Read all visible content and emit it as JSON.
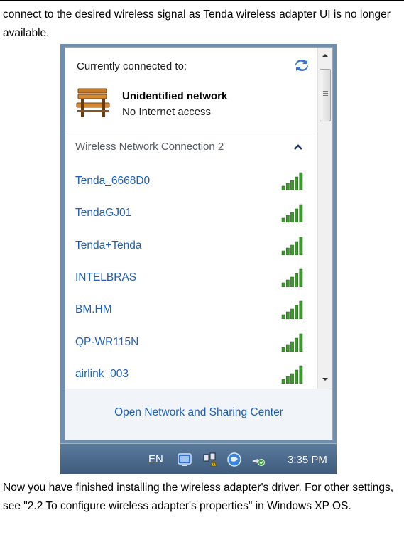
{
  "document": {
    "paragraph_top": "connect to the desired wireless signal as Tenda wireless adapter UI is no longer available.",
    "paragraph_bottom": "Now you have finished installing the wireless adapter's driver. For other settings, see \"2.2 To configure wireless adapter's properties\" in Windows XP OS."
  },
  "flyout": {
    "current_title": "Currently connected to:",
    "current_network": {
      "name": "Unidentified network",
      "status": "No Internet access",
      "icon": "bench-icon"
    },
    "section_header": "Wireless Network Connection 2",
    "networks": [
      {
        "label": "Tenda_6668D0",
        "signal": 5
      },
      {
        "label": "TendaGJ01",
        "signal": 5
      },
      {
        "label": "Tenda+Tenda",
        "signal": 5
      },
      {
        "label": "INTELBRAS",
        "signal": 5
      },
      {
        "label": "BM.HM",
        "signal": 5
      },
      {
        "label": "QP-WR115N",
        "signal": 5
      },
      {
        "label": "airlink_003",
        "signal": 5
      }
    ],
    "footer_link": "Open Network and Sharing Center"
  },
  "taskbar": {
    "language": "EN",
    "clock": "3:35 PM",
    "tray_icons": [
      "monitor-icon",
      "network-warning-icon",
      "globe-icon",
      "wifi-connect-icon"
    ]
  },
  "colors": {
    "link": "#1f5fb4",
    "signal": "#3a9a2a",
    "taskbar": "#4a6a8c"
  }
}
